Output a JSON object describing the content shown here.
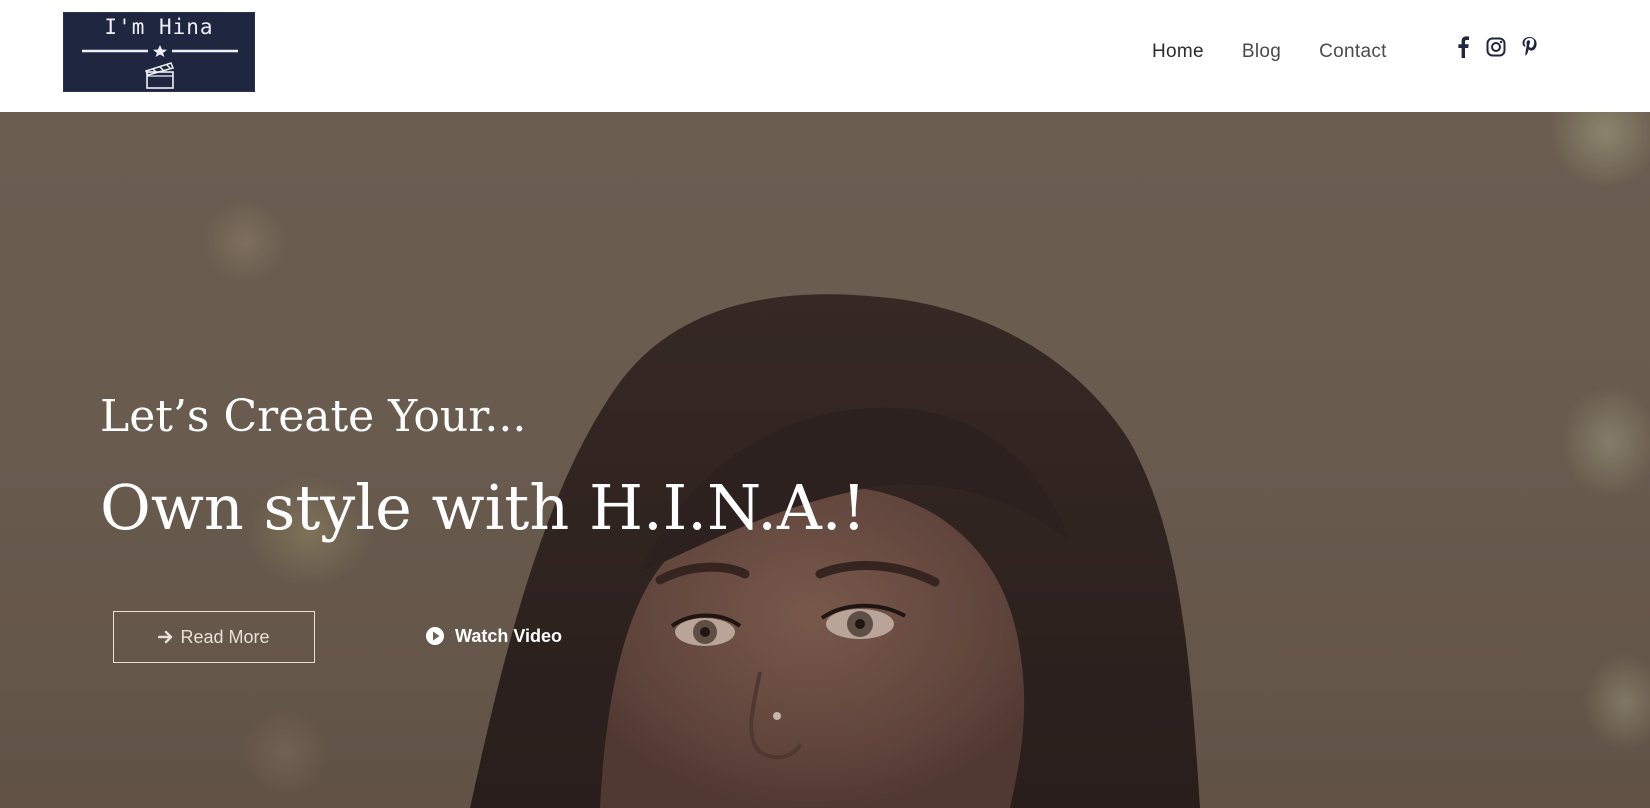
{
  "header": {
    "logo_text": "I'm Hina",
    "nav": [
      {
        "label": "Home"
      },
      {
        "label": "Blog"
      },
      {
        "label": "Contact"
      }
    ],
    "social": [
      "facebook-icon",
      "instagram-icon",
      "pinterest-icon"
    ]
  },
  "hero": {
    "subtitle": "Let’s Create Your...",
    "title": "Own style with H.I.N.A.!",
    "read_more_label": "Read More",
    "watch_video_label": "Watch Video"
  },
  "colors": {
    "logo_bg": "#1f2640",
    "nav_text": "#4a4a4a",
    "hero_overlay": "#7a6c5c",
    "hero_text": "#ffffff",
    "button_border": "#e9dfd5"
  }
}
